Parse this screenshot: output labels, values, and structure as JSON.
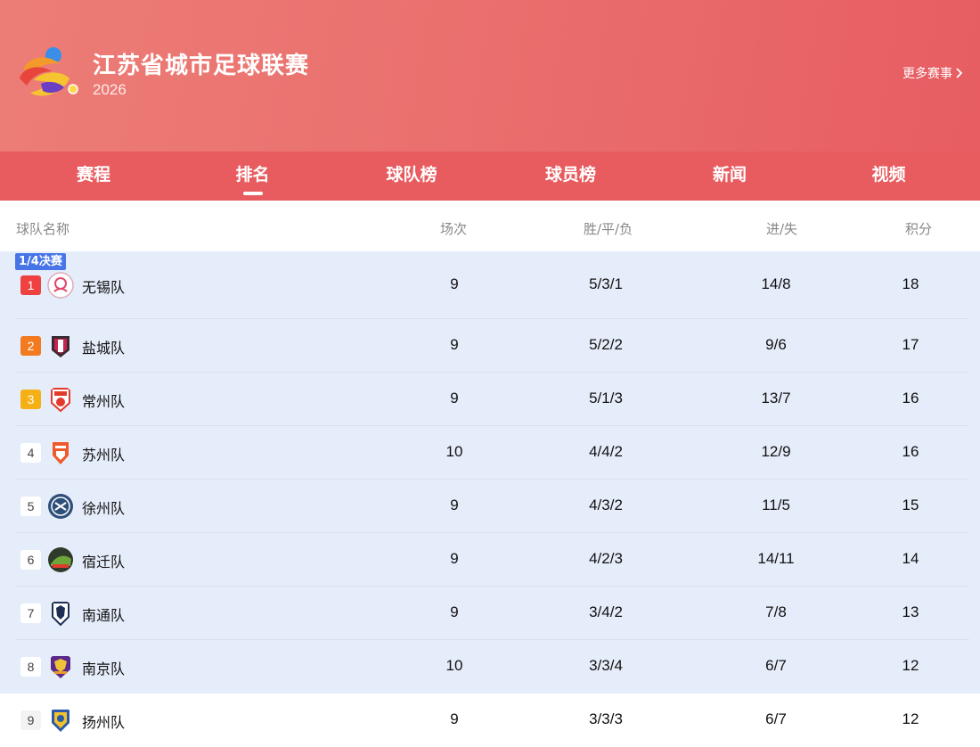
{
  "header": {
    "title": "江苏省城市足球联赛",
    "year": "2026",
    "more_label": "更多赛事"
  },
  "tabs": [
    {
      "label": "赛程",
      "active": false
    },
    {
      "label": "排名",
      "active": true
    },
    {
      "label": "球队榜",
      "active": false
    },
    {
      "label": "球员榜",
      "active": false
    },
    {
      "label": "新闻",
      "active": false
    },
    {
      "label": "视频",
      "active": false
    }
  ],
  "table": {
    "headers": {
      "team": "球队名称",
      "played": "场次",
      "wdl": "胜/平/负",
      "gd": "进/失",
      "points": "积分"
    },
    "stage_tag": "1/4决赛",
    "rows": [
      {
        "rank": "1",
        "team": "无锡队",
        "played": "9",
        "wdl": "5/3/1",
        "gd": "14/8",
        "points": "18"
      },
      {
        "rank": "2",
        "team": "盐城队",
        "played": "9",
        "wdl": "5/2/2",
        "gd": "9/6",
        "points": "17"
      },
      {
        "rank": "3",
        "team": "常州队",
        "played": "9",
        "wdl": "5/1/3",
        "gd": "13/7",
        "points": "16"
      },
      {
        "rank": "4",
        "team": "苏州队",
        "played": "10",
        "wdl": "4/4/2",
        "gd": "12/9",
        "points": "16"
      },
      {
        "rank": "5",
        "team": "徐州队",
        "played": "9",
        "wdl": "4/3/2",
        "gd": "11/5",
        "points": "15"
      },
      {
        "rank": "6",
        "team": "宿迁队",
        "played": "9",
        "wdl": "4/2/3",
        "gd": "14/11",
        "points": "14"
      },
      {
        "rank": "7",
        "team": "南通队",
        "played": "9",
        "wdl": "3/4/2",
        "gd": "7/8",
        "points": "13"
      },
      {
        "rank": "8",
        "team": "南京队",
        "played": "10",
        "wdl": "3/3/4",
        "gd": "6/7",
        "points": "12"
      },
      {
        "rank": "9",
        "team": "扬州队",
        "played": "9",
        "wdl": "3/3/3",
        "gd": "6/7",
        "points": "12"
      }
    ]
  },
  "colors": {
    "header_gradient_start": "#ec7d76",
    "header_gradient_end": "#e75d62",
    "tab_bar": "#e85c60",
    "qualified_row": "#e6edfa",
    "stage_tag": "#4775e8",
    "rank1": "#f04141",
    "rank2": "#f47a1f",
    "rank3": "#f5b016"
  },
  "icons": {
    "league_logo": "league-logo-icon",
    "more_arrow": "chevron-right-icon",
    "team_badges": [
      "wuxi-badge-icon",
      "yancheng-badge-icon",
      "changzhou-badge-icon",
      "suzhou-badge-icon",
      "xuzhou-badge-icon",
      "suqian-badge-icon",
      "nantong-badge-icon",
      "nanjing-badge-icon",
      "yangzhou-badge-icon"
    ]
  }
}
